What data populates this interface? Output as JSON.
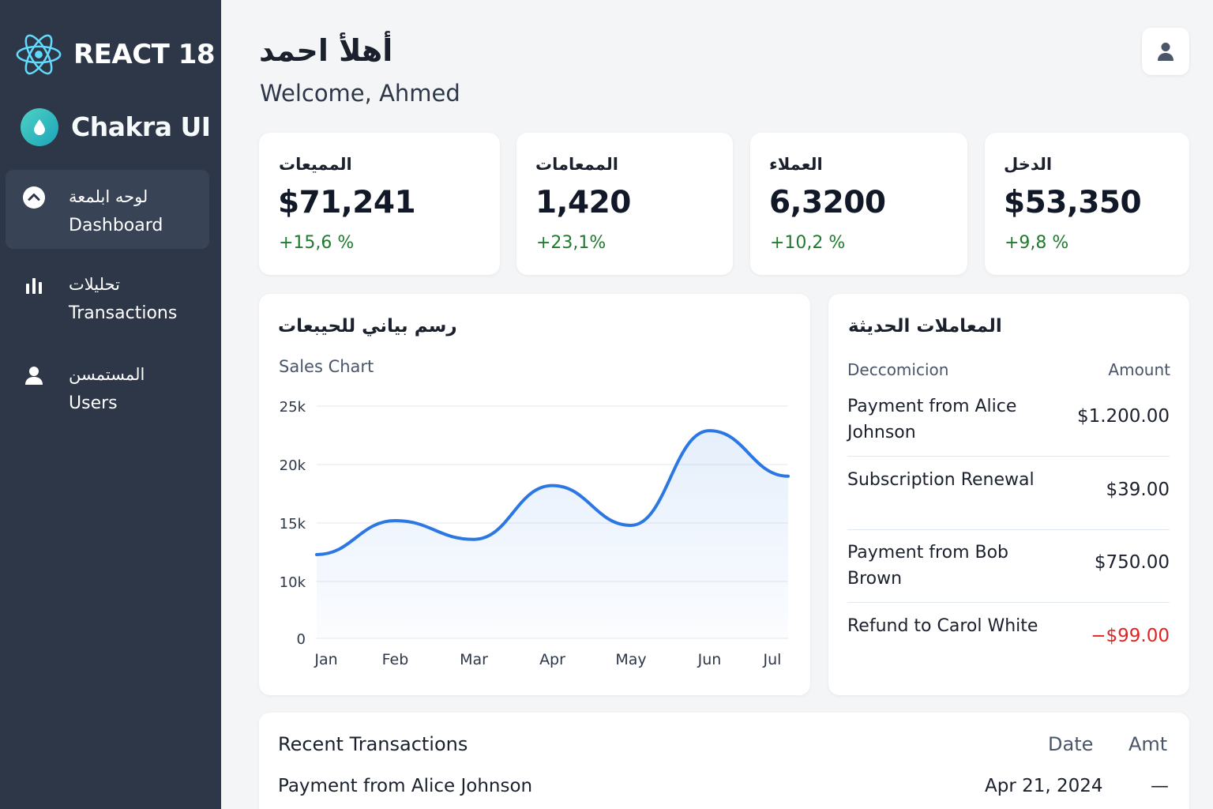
{
  "sidebar": {
    "brand": "REACT 18",
    "ui_lib": "Chakra UI",
    "items": [
      {
        "label_ar": "لوحه ابلمعة",
        "label_en": "Dashboard",
        "icon": "chevron-up-circle-icon",
        "active": true
      },
      {
        "label_ar": "تحليلات",
        "label_en": "Transactions",
        "icon": "bar-chart-icon",
        "active": false
      },
      {
        "label_ar": "المستمسن",
        "label_en": "Users",
        "icon": "user-icon",
        "active": false
      }
    ]
  },
  "header": {
    "greeting_ar": "أهلأ احمد",
    "greeting_en": "Welcome, Ahmed",
    "user_icon": "user-icon"
  },
  "stats": [
    {
      "label": "المميعات",
      "value": "$71,241",
      "change": "+15,6 %"
    },
    {
      "label": "الممعامات",
      "value": "1,420",
      "change": "+23,1%"
    },
    {
      "label": "العملاء",
      "value": "6,3200",
      "change": "+10,2 %"
    },
    {
      "label": "الدخل",
      "value": "$53,350",
      "change": "+9,8 %"
    }
  ],
  "chart_panel": {
    "title_ar": "رسم بياني للحيبعات",
    "subtitle": "Sales Chart"
  },
  "chart_data": {
    "type": "area",
    "categories": [
      "Jan",
      "Feb",
      "Mar",
      "Apr",
      "May",
      "Jun",
      "Jul"
    ],
    "series": [
      {
        "values": [
          12300,
          15200,
          13600,
          18200,
          14800,
          22900,
          19000
        ]
      }
    ],
    "ylim": [
      0,
      25000
    ],
    "yticks": [
      0,
      10000,
      15000,
      20000,
      25000
    ],
    "ytick_labels": [
      "0",
      "10k",
      "15k",
      "20k",
      "25k"
    ],
    "grid": true,
    "line_color": "#2b77e4"
  },
  "recent_panel": {
    "title_ar": "المعاملات الحديثة",
    "col_desc": "Deccomicion",
    "col_amount": "Amount",
    "rows": [
      {
        "desc": "Payment from Alice Johnson",
        "amount": "$1.200.00",
        "negative": false
      },
      {
        "desc": "Subscription Renewal",
        "amount": "$39.00",
        "negative": false
      },
      {
        "desc": "Payment from Bob Brown",
        "amount": "$750.00",
        "negative": false
      },
      {
        "desc": "Refund to Carol White",
        "amount": "−$99.00",
        "negative": true
      }
    ]
  },
  "bottom_table": {
    "title": "Recent Transactions",
    "col_date": "Date",
    "col_amt": "Amt",
    "rows": [
      {
        "desc": "Payment from Alice Johnson",
        "date": "Apr 21, 2024",
        "amt": "—"
      }
    ]
  },
  "colors": {
    "sidebar": "#2d3748",
    "positive": "#1f7a2e",
    "negative": "#e02424",
    "accent": "#2b77e4"
  }
}
